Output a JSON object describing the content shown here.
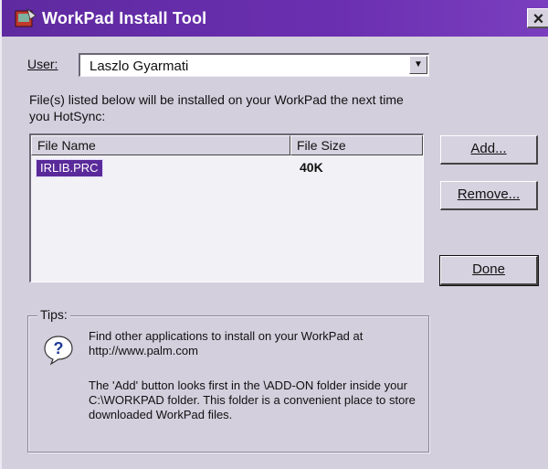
{
  "window": {
    "title": "WorkPad Install Tool",
    "close_glyph": "×",
    "app_icon": "palm-install-icon"
  },
  "user": {
    "label": "User:",
    "selected": "Laszlo Gyarmati",
    "arrow_glyph": "▼"
  },
  "description": "File(s) listed below will be installed on your WorkPad the next time you HotSync:",
  "file_list": {
    "headers": [
      "File Name",
      "File Size"
    ],
    "rows": [
      {
        "name": "IRLIB.PRC",
        "size": "40K"
      }
    ]
  },
  "buttons": {
    "add": "Add...",
    "remove": "Remove...",
    "done": "Done"
  },
  "tips": {
    "legend": "Tips:",
    "icon": "question-icon",
    "line1": "Find other applications to install on your WorkPad at http://www.palm.com",
    "line2": "The 'Add' button looks first in the \\ADD-ON folder inside your C:\\WORKPAD folder. This folder is a convenient place to store downloaded WorkPad files."
  },
  "colors": {
    "titlebar": "#6a2fb0",
    "selection": "#5a2a9a",
    "face": "#d3cfdd"
  }
}
